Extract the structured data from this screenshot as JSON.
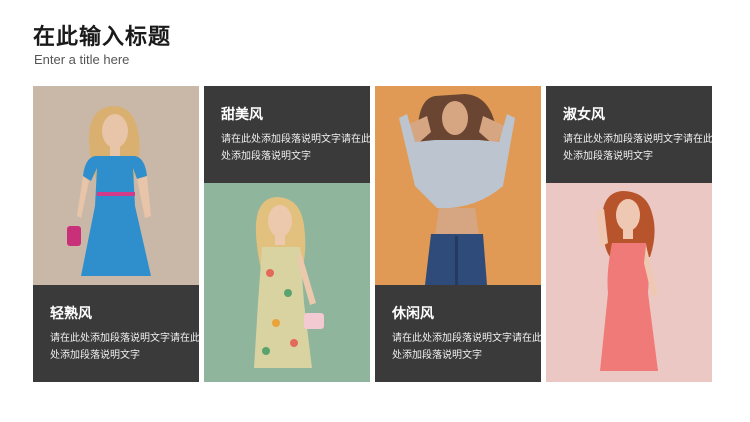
{
  "header": {
    "title": "在此输入标题",
    "subtitle": "Enter a title here"
  },
  "cards": [
    {
      "title": "轻熟风",
      "desc": "请在此处添加段落说明文字请在此处添加段落说明文字"
    },
    {
      "title": "甜美风",
      "desc": "请在此处添加段落说明文字请在此处添加段落说明文字"
    },
    {
      "title": "休闲风",
      "desc": "请在此处添加段落说明文字请在此处添加段落说明文字"
    },
    {
      "title": "淑女风",
      "desc": "请在此处添加段落说明文字请在此处添加段落说明文字"
    }
  ],
  "colors": {
    "panel": "#3a3a3a",
    "photo1_bg": "#c9b8a8",
    "photo2_bg": "#8fb59c",
    "photo3_bg": "#e09a55",
    "photo4_bg": "#ecc8c4"
  }
}
